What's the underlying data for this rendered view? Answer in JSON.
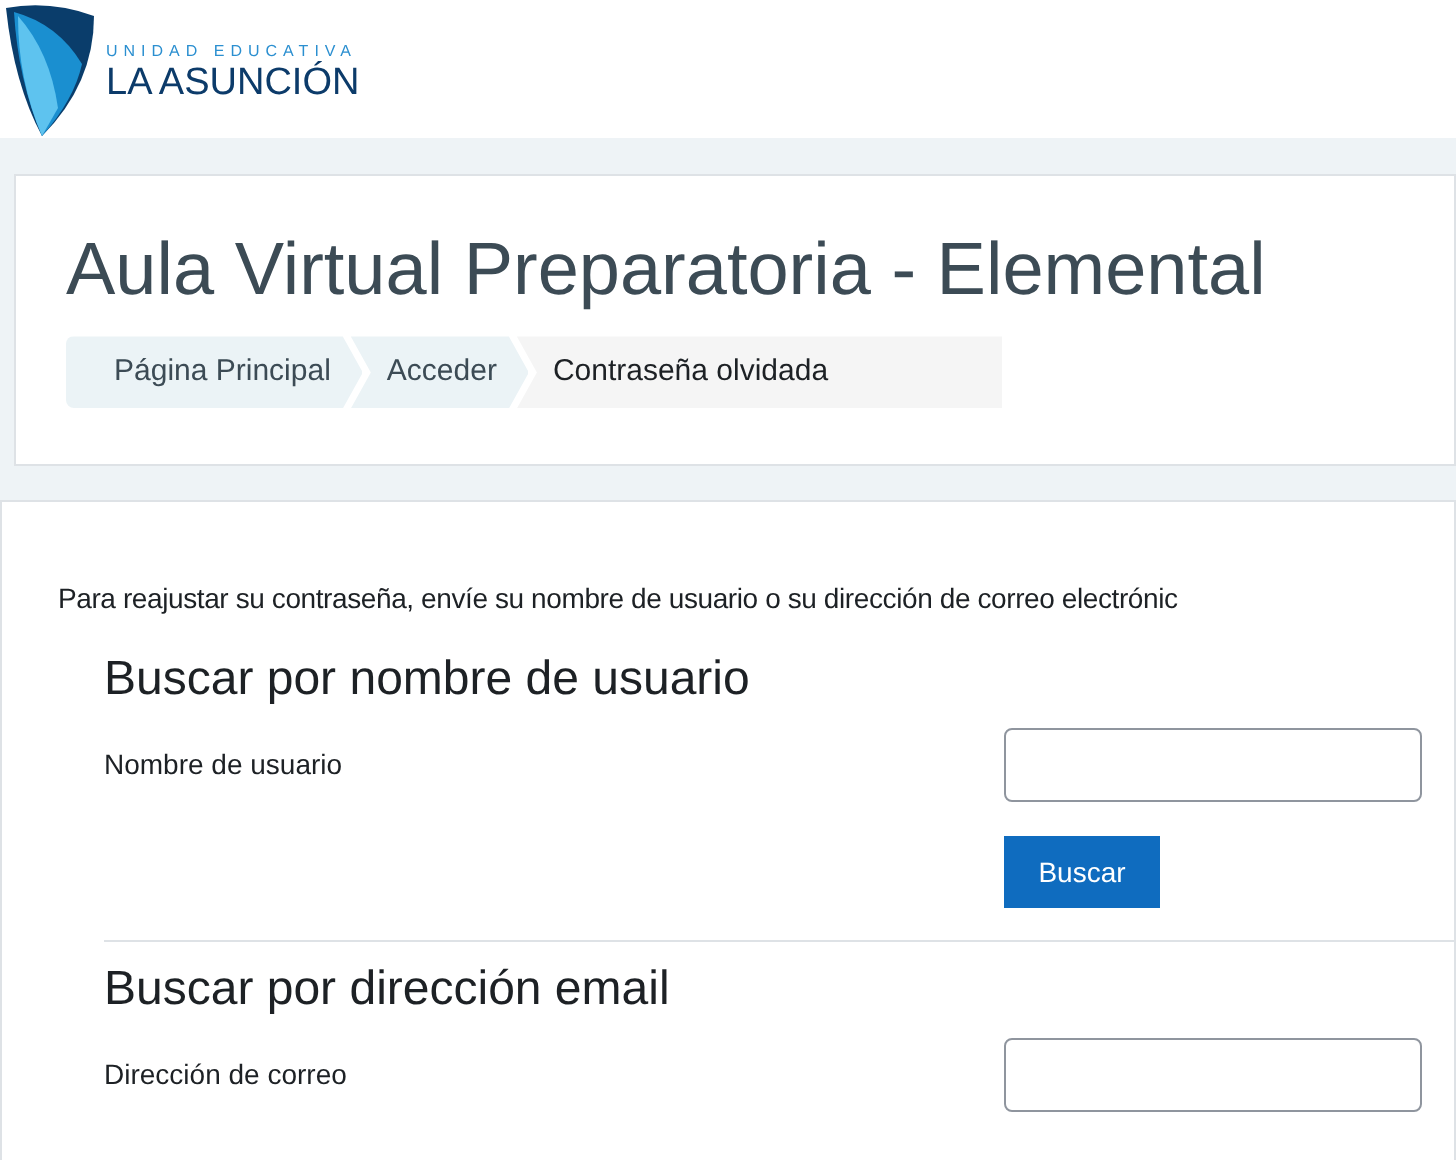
{
  "logo": {
    "subtitle": "UNIDAD EDUCATIVA",
    "name": "LA ASUNCIÓN"
  },
  "page_title": "Aula Virtual Preparatoria - Elemental",
  "breadcrumb": [
    {
      "label": "Página Principal",
      "selected": false
    },
    {
      "label": "Acceder",
      "selected": false
    },
    {
      "label": "Contraseña olvidada",
      "selected": true
    }
  ],
  "intro": "Para reajustar su contraseña, envíe su nombre de usuario o su dirección de correo electrónic",
  "sections": [
    {
      "heading": "Buscar por nombre de usuario",
      "field_label": "Nombre de usuario",
      "button": "Buscar"
    },
    {
      "heading": "Buscar por dirección email",
      "field_label": "Dirección de correo"
    }
  ]
}
